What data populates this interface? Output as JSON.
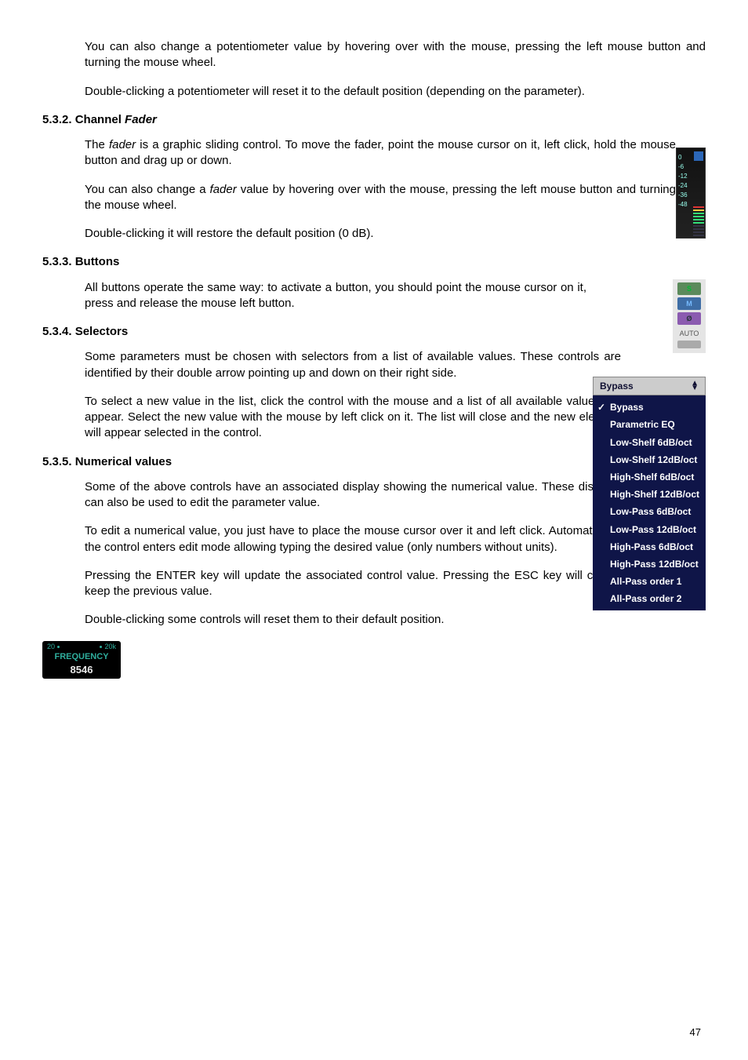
{
  "paragraphs": {
    "p1": "You can also change a potentiometer value by hovering over with the mouse, pressing the left mouse button and turning the mouse wheel.",
    "p2": "Double-clicking a potentiometer will reset it to the default position (depending on the parameter).",
    "p3a": "The ",
    "p3_em1": "fader",
    "p3b": " is a graphic sliding control. To move the fader, point the mouse cursor on it, left click, hold the mouse button and drag up or down.",
    "p4a": "You can also change a ",
    "p4_em1": "fader",
    "p4b": " value by hovering over with the mouse, pressing the left mouse button and turning the mouse wheel.",
    "p5": "Double-clicking it will restore the default position (0 dB).",
    "p6": "All buttons operate the same way: to activate a button, you should point the mouse cursor on it, press and release the mouse left button.",
    "p7": "Some parameters must be chosen with selectors from a list of available values. These controls are identified by their double arrow pointing up and down on their right side.",
    "p8": "To select a new value in the list, click the control with the mouse and a list of all available values will appear. Select the new value with the mouse by left click on it. The list will close and the new element will appear selected in the control.",
    "p9": "Some of the above controls have an associated display showing the numerical value. These displays can also be used to edit the parameter value.",
    "p10": "To edit a numerical value, you just have to place the mouse cursor over it and left click. Automatically, the control enters edit mode allowing typing the desired value (only numbers without units).",
    "p11": "Pressing the ENTER key will update the associated control value. Pressing the ESC key will cancel the editing and keep the previous value.",
    "p12": "Double-clicking some controls will reset them to their default position."
  },
  "headings": {
    "h532a": "5.3.2. Channel ",
    "h532b": "Fader",
    "h533": "5.3.3. Buttons",
    "h534": "5.3.4. Selectors",
    "h535": "5.3.5. Numerical values"
  },
  "fader_ticks": {
    "t0": "0",
    "t6": "-6",
    "t12": "-12",
    "t24": "-24",
    "t36": "-36",
    "t48": "-48"
  },
  "btns": {
    "s": "S",
    "m": "M",
    "phi": "Ø",
    "auto": "AUTO"
  },
  "selector": {
    "head": "Bypass",
    "items": [
      "Bypass",
      "Parametric EQ",
      "Low-Shelf 6dB/oct",
      "Low-Shelf 12dB/oct",
      "High-Shelf 6dB/oct",
      "High-Shelf 12dB/oct",
      "Low-Pass 6dB/oct",
      "Low-Pass 12dB/oct",
      "High-Pass 6dB/oct",
      "High-Pass 12dB/oct",
      "All-Pass order 1",
      "All-Pass order 2"
    ]
  },
  "freq": {
    "lo": "20",
    "hi": "20k",
    "label": "FREQUENCY",
    "value": "8546"
  },
  "page": "47"
}
